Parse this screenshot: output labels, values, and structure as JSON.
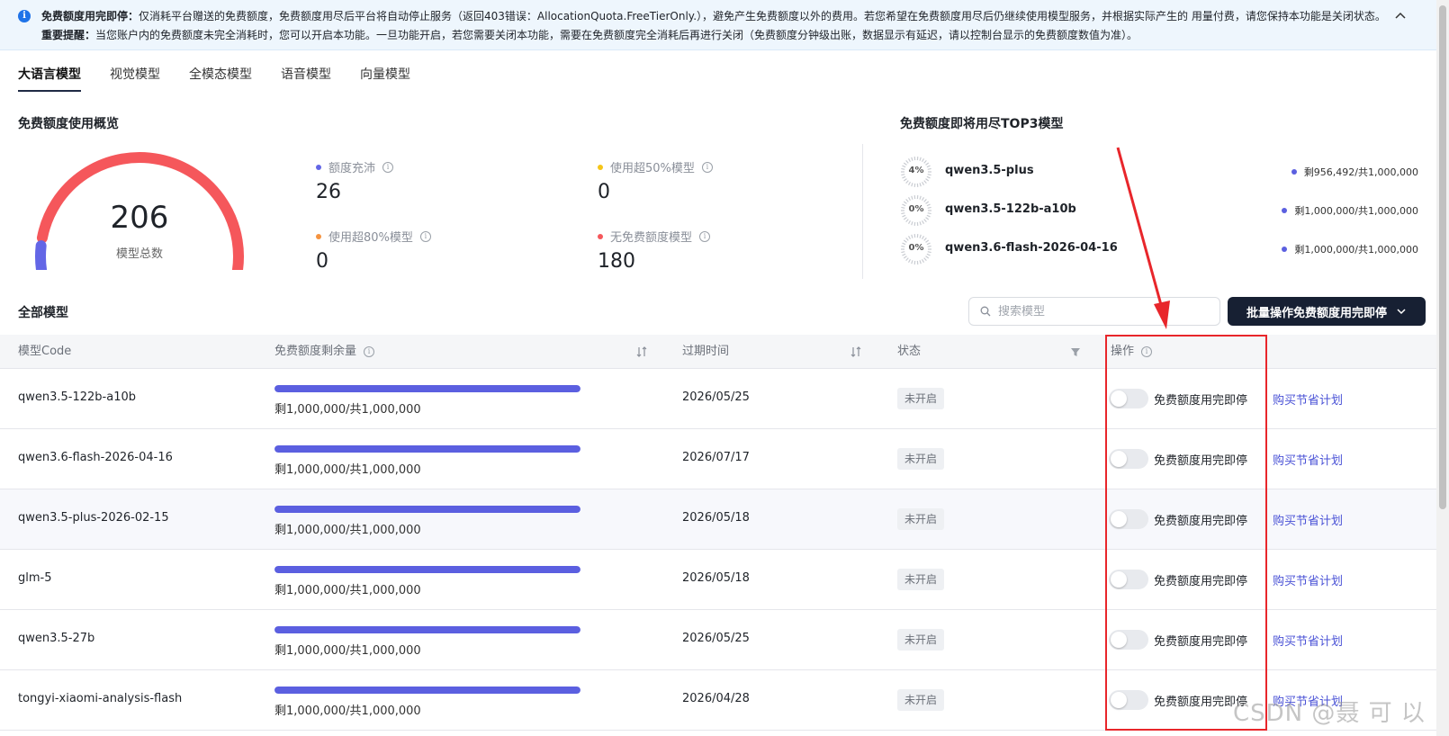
{
  "notice": {
    "line1_bold": "免费额度用完即停：",
    "line1": "仅消耗平台赠送的免费额度，免费额度用尽后平台将自动停止服务（返回403错误：AllocationQuota.FreeTierOnly.），避免产生免费额度以外的费用。若您希望在免费额度用尽后仍继续使用模型服务，并根据实际产生的 用量付费，请您保持本功能是关闭状态。",
    "line2_bold": "重要提醒：",
    "line2": "当您账户内的免费额度未完全消耗时，您可以开启本功能。一旦功能开启，若您需要关闭本功能，需要在免费额度完全消耗后再进行关闭（免费额度分钟级出账，数据显示有延迟，请以控制台显示的免费额度数值为准）。"
  },
  "tabs": [
    {
      "label": "大语言模型",
      "active": true
    },
    {
      "label": "视觉模型"
    },
    {
      "label": "全模态模型"
    },
    {
      "label": "语音模型"
    },
    {
      "label": "向量模型"
    }
  ],
  "overview": {
    "title": "免费额度使用概览",
    "total": "206",
    "total_label": "模型总数",
    "gauge": {
      "share_filled": 0.1,
      "fill_color": "#6366e6",
      "rest_color": "#f5575b"
    },
    "stats": [
      {
        "label": "额度充沛",
        "value": "26",
        "color": "#6366e6"
      },
      {
        "label": "使用超50%模型",
        "value": "0",
        "color": "#f5c518"
      },
      {
        "label": "使用超80%模型",
        "value": "0",
        "color": "#f59340"
      },
      {
        "label": "无免费额度模型",
        "value": "180",
        "color": "#f5575b"
      }
    ]
  },
  "top3": {
    "title": "免费额度即将用尽TOP3模型",
    "items": [
      {
        "percent": "4%",
        "name": "qwen3.5-plus",
        "remain": "剩956,492/共1,000,000"
      },
      {
        "percent": "0%",
        "name": "qwen3.5-122b-a10b",
        "remain": "剩1,000,000/共1,000,000"
      },
      {
        "percent": "0%",
        "name": "qwen3.6-flash-2026-04-16",
        "remain": "剩1,000,000/共1,000,000"
      }
    ]
  },
  "all_models": {
    "title": "全部模型",
    "search_placeholder": "搜索模型",
    "batch_button": "批量操作免费额度用完即停"
  },
  "table": {
    "headers": {
      "code": "模型Code",
      "remain": "免费额度剩余量",
      "expire": "过期时间",
      "status": "状态",
      "action": "操作"
    },
    "rows": [
      {
        "code": "qwen3.5-122b-a10b",
        "fraction": 1.0,
        "remain": "剩1,000,000/共1,000,000",
        "expire": "2026/05/25",
        "status": "未开启",
        "switch_label": "免费额度用完即停",
        "link": "购买节省计划"
      },
      {
        "code": "qwen3.6-flash-2026-04-16",
        "fraction": 1.0,
        "remain": "剩1,000,000/共1,000,000",
        "expire": "2026/07/17",
        "status": "未开启",
        "switch_label": "免费额度用完即停",
        "link": "购买节省计划"
      },
      {
        "code": "qwen3.5-plus-2026-02-15",
        "fraction": 1.0,
        "remain": "剩1,000,000/共1,000,000",
        "expire": "2026/05/18",
        "status": "未开启",
        "switch_label": "免费额度用完即停",
        "link": "购买节省计划"
      },
      {
        "code": "glm-5",
        "fraction": 1.0,
        "remain": "剩1,000,000/共1,000,000",
        "expire": "2026/05/18",
        "status": "未开启",
        "switch_label": "免费额度用完即停",
        "link": "购买节省计划"
      },
      {
        "code": "qwen3.5-27b",
        "fraction": 1.0,
        "remain": "剩1,000,000/共1,000,000",
        "expire": "2026/05/25",
        "status": "未开启",
        "switch_label": "免费额度用完即停",
        "link": "购买节省计划"
      },
      {
        "code": "tongyi-xiaomi-analysis-flash",
        "fraction": 1.0,
        "remain": "剩1,000,000/共1,000,000",
        "expire": "2026/04/28",
        "status": "未开启",
        "switch_label": "免费额度用完即停",
        "link": "购买节省计划"
      }
    ]
  },
  "watermark": "CSDN @聂 可 以",
  "colors": {
    "accent": "#5b5fe0",
    "annotation": "#e8262b",
    "dark_button": "#172033"
  }
}
